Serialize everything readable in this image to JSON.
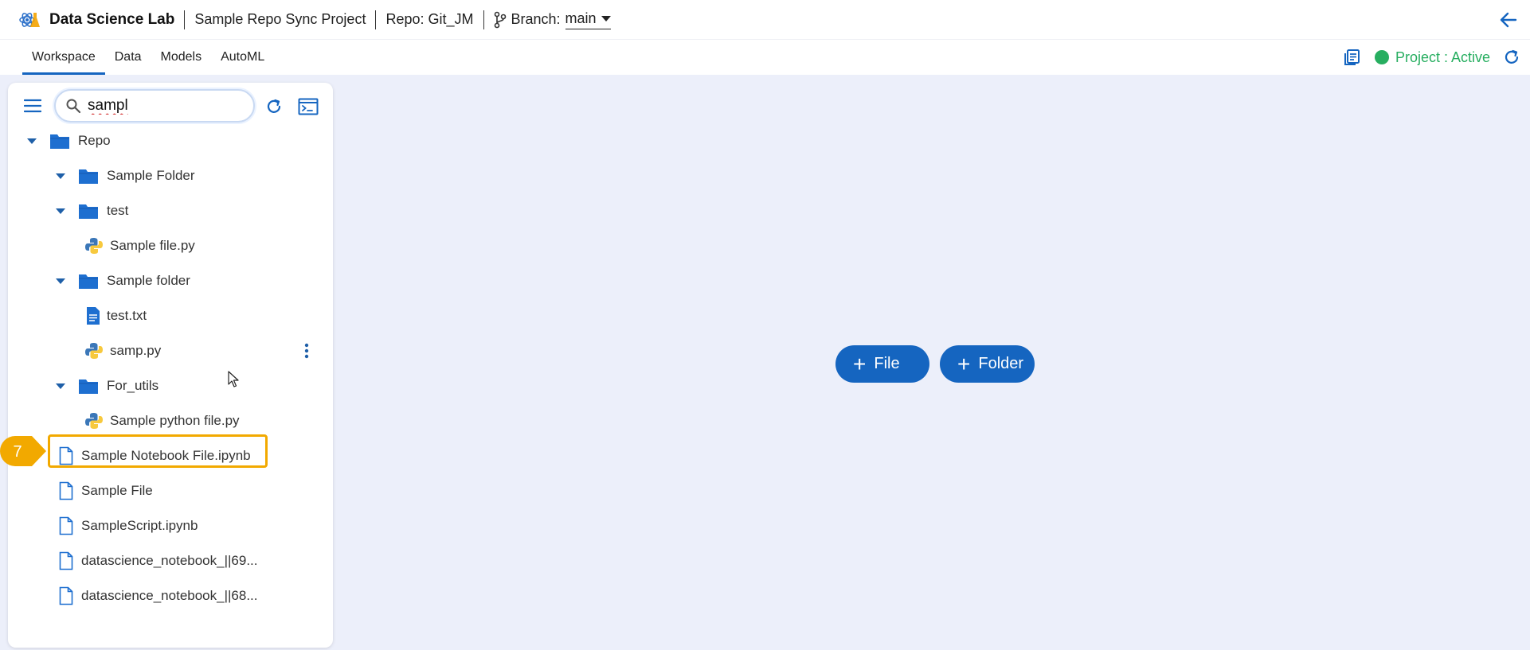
{
  "header": {
    "app_title": "Data Science Lab",
    "project_name": "Sample Repo Sync Project",
    "repo": "Repo: Git_JM",
    "branch_label": "Branch:",
    "branch_value": "main"
  },
  "nav": {
    "tabs": [
      "Workspace",
      "Data",
      "Models",
      "AutoML"
    ],
    "active_tab": "Workspace",
    "project_status": "Project : Active"
  },
  "sidebar": {
    "search_value": "sampl",
    "tree": [
      {
        "label": "Repo",
        "type": "folder"
      },
      {
        "label": "Sample Folder",
        "type": "folder"
      },
      {
        "label": "test",
        "type": "folder"
      },
      {
        "label": "Sample file.py",
        "type": "python"
      },
      {
        "label": "Sample folder",
        "type": "folder"
      },
      {
        "label": "test.txt",
        "type": "text"
      },
      {
        "label": "samp.py",
        "type": "python"
      },
      {
        "label": "For_utils",
        "type": "folder"
      },
      {
        "label": "Sample python file.py",
        "type": "python"
      },
      {
        "label": "Sample Notebook File.ipynb",
        "type": "file"
      },
      {
        "label": "Sample File",
        "type": "file"
      },
      {
        "label": "SampleScript.ipynb",
        "type": "file"
      },
      {
        "label": "datascience_notebook_||69...",
        "type": "file"
      },
      {
        "label": "datascience_notebook_||68...",
        "type": "file"
      }
    ]
  },
  "annotation": {
    "step": "7"
  },
  "main": {
    "add_file_label": "File",
    "add_folder_label": "Folder"
  },
  "colors": {
    "primary": "#1565c0",
    "highlight": "#f2a900",
    "status_active": "#27ae60",
    "background": "#eceffa"
  }
}
